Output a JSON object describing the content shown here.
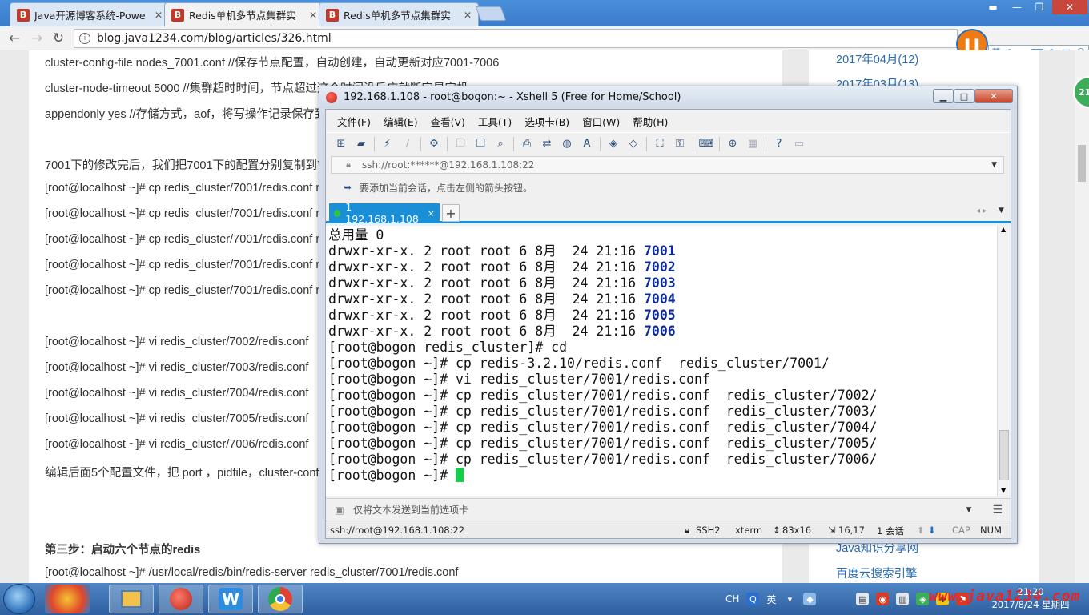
{
  "browser": {
    "tabs": [
      {
        "title": "Java开源博客系统-Powe",
        "active": false
      },
      {
        "title": "Redis单机多节点集群实",
        "active": true
      },
      {
        "title": "Redis单机多节点集群实",
        "active": false
      }
    ],
    "url": "blog.java1234.com/blog/articles/326.html"
  },
  "article": {
    "lines": [
      "cluster-config-file nodes_7001.conf  //保存节点配置，自动创建，自动更新对应7001-7006",
      "cluster-node-timeout 5000    //集群超时时间，节点超过这个时间没反应就断定是宕机",
      "appendonly yes   //存储方式，aof，将写操作记录保存到日志中",
      "7001下的修改完后，我们把7001下的配置分别复制到7002-7006 然后对应的再修改下配置即可；",
      "[root@localhost ~]# cp redis_cluster/7001/redis.conf redis_cluster/7002/",
      "[root@localhost ~]# cp redis_cluster/7001/redis.conf redis_cluster/7003/",
      "[root@localhost ~]# cp redis_cluster/7001/redis.conf redis_cluster/7004/",
      "[root@localhost ~]# cp redis_cluster/7001/redis.conf redis_cluster/7005/",
      "[root@localhost ~]# cp redis_cluster/7001/redis.conf redis_cluster/7006/",
      "[root@localhost ~]# vi redis_cluster/7002/redis.conf",
      "[root@localhost ~]# vi redis_cluster/7003/redis.conf",
      "[root@localhost ~]# vi redis_cluster/7004/redis.conf",
      "[root@localhost ~]# vi redis_cluster/7005/redis.conf",
      "[root@localhost ~]# vi redis_cluster/7006/redis.conf",
      "编辑后面5个配置文件，把 port ，pidfile，cluster-config-file 分别修改下即可；",
      "第三步：启动六个节点的redis",
      "[root@localhost ~]# /usr/local/redis/bin/redis-server redis_cluster/7001/redis.conf"
    ]
  },
  "sidebar": {
    "archives": [
      "2017年04月(12)",
      "2017年03月(13)"
    ],
    "links": [
      "Java知识分享网",
      "百度云搜索引擎"
    ]
  },
  "xshell": {
    "title": "192.168.1.108 - root@bogon:~ - Xshell 5 (Free for Home/School)",
    "menu": [
      "文件(F)",
      "编辑(E)",
      "查看(V)",
      "工具(T)",
      "选项卡(B)",
      "窗口(W)",
      "帮助(H)"
    ],
    "address": "ssh://root:******@192.168.1.108:22",
    "hint": "要添加当前会话，点击左侧的箭头按钮。",
    "tab": {
      "label": "1 192.168.1.108",
      "close": "×",
      "add": "+"
    },
    "terminal": {
      "header": "总用量 0",
      "dir_prefix": "drwxr-xr-x. 2 root root 6 8月  24 21:16 ",
      "dirs": [
        "7001",
        "7002",
        "7003",
        "7004",
        "7005",
        "7006"
      ],
      "commands": [
        "[root@bogon redis_cluster]# cd",
        "[root@bogon ~]# cp redis-3.2.10/redis.conf  redis_cluster/7001/",
        "[root@bogon ~]# vi redis_cluster/7001/redis.conf",
        "[root@bogon ~]# cp redis_cluster/7001/redis.conf  redis_cluster/7002/",
        "[root@bogon ~]# cp redis_cluster/7001/redis.conf  redis_cluster/7003/",
        "[root@bogon ~]# cp redis_cluster/7001/redis.conf  redis_cluster/7004/",
        "[root@bogon ~]# cp redis_cluster/7001/redis.conf  redis_cluster/7005/",
        "[root@bogon ~]# cp redis_cluster/7001/redis.conf  redis_cluster/7006/"
      ],
      "prompt": "[root@bogon ~]# "
    },
    "send_placeholder": "仅将文本发送到当前选项卡",
    "status": {
      "conn": "ssh://root@192.168.1.108:22",
      "proto": "SSH2",
      "term": "xterm",
      "size": "83x16",
      "pos": "16,17",
      "sessions": "1 会话",
      "cap": "CAP",
      "num": "NUM"
    }
  },
  "taskbar": {
    "lang": "CH",
    "ime": "英",
    "time": "21:20",
    "date": "2017/8/24 星期四",
    "watermark": "www.java1234.com"
  },
  "overlay": {
    "badge": "21"
  }
}
